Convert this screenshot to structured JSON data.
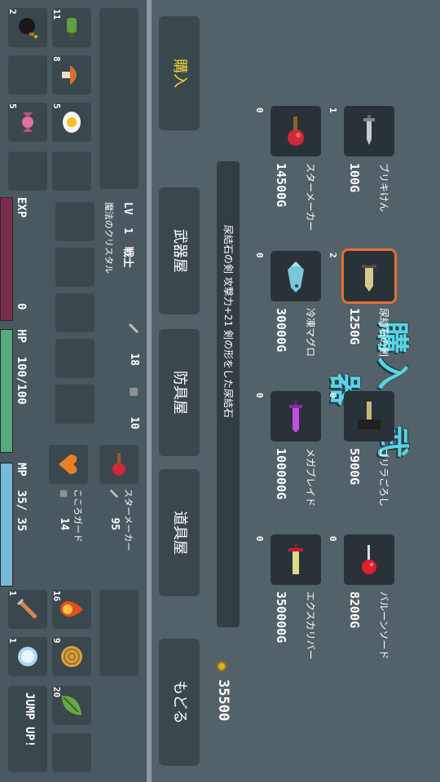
{
  "shop": {
    "title_left": "購入",
    "title_right": "武器",
    "items": [
      {
        "name": "ブリキけん",
        "price": "100G",
        "count": "1",
        "icon": "tin-sword-icon"
      },
      {
        "name": "スターメーカー",
        "price": "14500G",
        "count": "0",
        "icon": "star-maker-mace-icon"
      },
      {
        "name": "尿結石の剣",
        "price": "1250G",
        "count": "2",
        "icon": "kidney-stone-sword-icon"
      },
      {
        "name": "冷凍マグロ",
        "price": "30000G",
        "count": "0",
        "icon": "frozen-tuna-icon"
      },
      {
        "name": "ゴリラごろし",
        "price": "5900G",
        "count": "0",
        "icon": "hammer-icon"
      },
      {
        "name": "メガブレイド",
        "price": "100000G",
        "count": "0",
        "icon": "mega-blade-icon"
      },
      {
        "name": "バルーンソード",
        "price": "8200G",
        "count": "0",
        "icon": "balloon-sword-icon"
      },
      {
        "name": "エクスカリバー",
        "price": "350000G",
        "count": "0",
        "icon": "excalibur-icon"
      }
    ],
    "description": "尿結石の剣  攻撃力+21  剣の形をした尿結石",
    "money": "35500",
    "coin_icon": "coin-icon"
  },
  "nav": {
    "buy": "購入",
    "weapon_shop": "武器屋",
    "armor_shop": "防具屋",
    "item_shop": "道具屋",
    "back": "もどる"
  },
  "status": {
    "level_label": "LV",
    "level": "1",
    "job": "戦士",
    "title": "魔法のクリスタル",
    "attack": "18",
    "defense": "10",
    "exp_label": "EXP",
    "exp_value": "0",
    "exp_fill": 0.0,
    "hp_label": "HP",
    "hp_value": "100/100",
    "hp_fill": 1.0,
    "mp_label": "MP",
    "mp_value": "35/ 35",
    "mp_fill": 1.0,
    "weapon_name": "スターメーカー",
    "weapon_stat": "95",
    "armor_name": "こころガード",
    "armor_stat": "14"
  },
  "inventory": {
    "items": [
      {
        "icon": "bomb-icon",
        "count": "2"
      },
      {
        "icon": "potion-bottle-icon",
        "count": "11"
      },
      {
        "icon": "mushroom-icon",
        "count": "8"
      },
      {
        "icon": "candy-icon",
        "count": "5"
      },
      {
        "icon": "fried-egg-icon",
        "count": "5"
      }
    ],
    "skills": [
      {
        "icon": "sword-skill-icon",
        "count": "1"
      },
      {
        "icon": "fire-icon",
        "count": "16"
      },
      {
        "icon": "ice-orb-icon",
        "count": "1"
      },
      {
        "icon": "wind-spiral-icon",
        "count": "9"
      },
      {
        "icon": "leaf-icon",
        "count": "20"
      }
    ],
    "jump_label": "JUMP UP!"
  },
  "colors": {
    "exp_bar": "#7a2c4c",
    "hp_bar": "#5aa880",
    "mp_bar": "#7ab8d8",
    "selected_border": "#e07030",
    "title_cyan": "#5ad3e6",
    "active_nav": "#f2d83c"
  }
}
